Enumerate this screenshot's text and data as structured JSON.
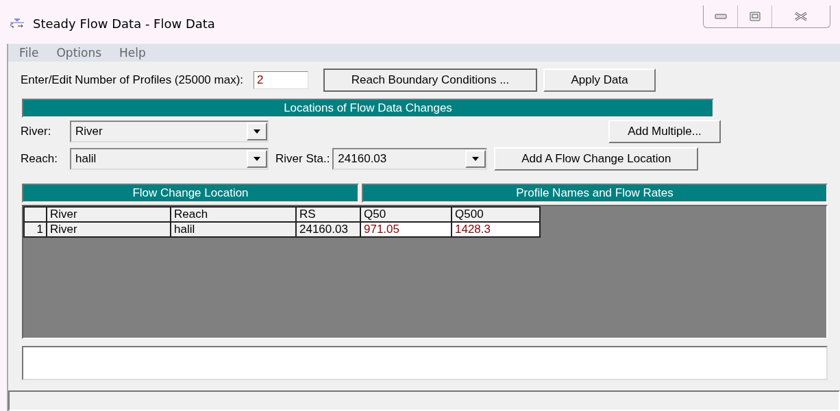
{
  "window": {
    "title": "Steady Flow Data - Flow Data"
  },
  "menu": [
    "File",
    "Options",
    "Help"
  ],
  "profiles": {
    "label": "Enter/Edit Number of Profiles (25000 max):",
    "value": "2"
  },
  "top_buttons": [
    "Reach Boundary Conditions ...",
    "Apply Data"
  ],
  "section_title": "Locations of Flow Data Changes",
  "river": {
    "label": "River:",
    "value": "River"
  },
  "reach": {
    "label": "Reach:",
    "value": "halil"
  },
  "station": {
    "label": "River Sta.:",
    "value": "24160.03"
  },
  "add_multiple": "Add Multiple...",
  "add_location": "Add A Flow Change Location",
  "table": {
    "groups": [
      "Flow Change Location",
      "Profile Names and Flow Rates"
    ],
    "columns": [
      "River",
      "Reach",
      "RS",
      "Q50",
      "Q500"
    ],
    "rows": [
      {
        "number": "1",
        "cells": [
          "River",
          "halil",
          "24160.03",
          "971.05",
          "1428.3"
        ]
      }
    ]
  }
}
